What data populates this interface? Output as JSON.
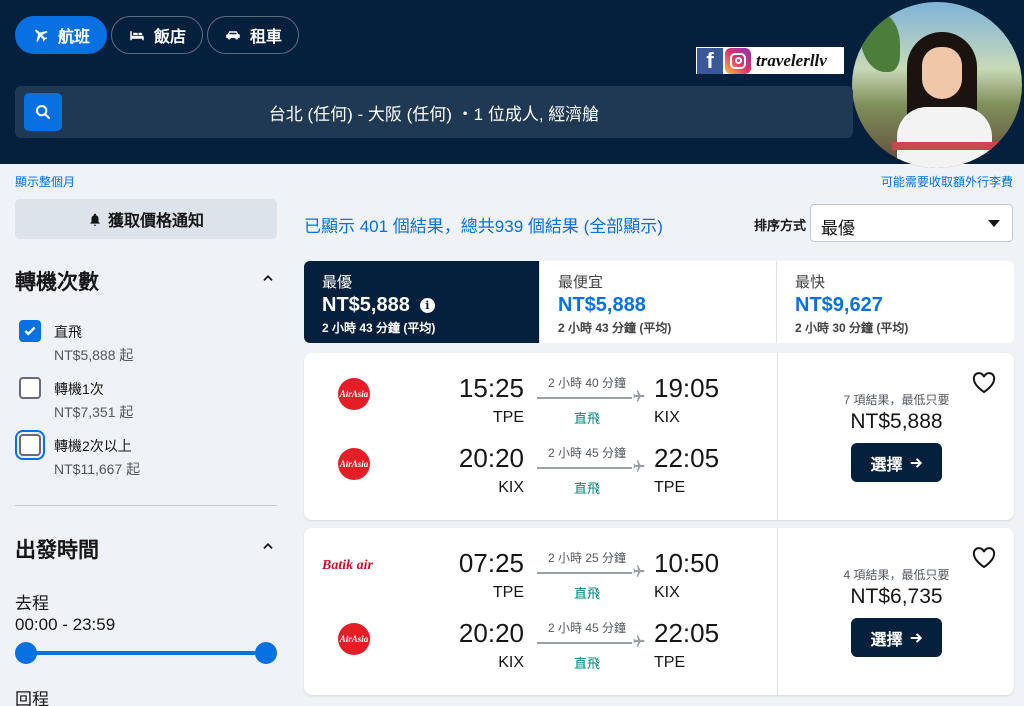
{
  "header": {
    "tabs": [
      {
        "label": "航班",
        "icon": "plane-icon",
        "active": true
      },
      {
        "label": "飯店",
        "icon": "bed-icon",
        "active": false
      },
      {
        "label": "租車",
        "icon": "car-icon",
        "active": false
      }
    ],
    "search_summary": "台北 (任何) - 大阪 (任何) ・1 位成人, 經濟艙",
    "watermark_handle": "travelerllv"
  },
  "left": {
    "show_month_link": "顯示整個月",
    "price_alert_label": "獲取價格通知",
    "stops_title": "轉機次數",
    "stops": [
      {
        "label": "直飛",
        "price": "NT$5,888 起",
        "checked": true
      },
      {
        "label": "轉機1次",
        "price": "NT$7,351 起",
        "checked": false
      },
      {
        "label": "轉機2次以上",
        "price": "NT$11,667 起",
        "checked": false
      }
    ],
    "departure_title": "出發時間",
    "outbound_label": "去程",
    "outbound_range": "00:00 - 23:59",
    "return_label": "回程"
  },
  "results": {
    "baggage_note": "可能需要收取額外行李費",
    "count_text": "已顯示 401 個結果，總共939 個結果 (全部顯示)",
    "sort_label": "排序方式",
    "sort_value": "最優",
    "sort_tabs": [
      {
        "name": "最優",
        "price": "NT$5,888",
        "duration": "2 小時 43 分鐘 (平均)",
        "active": true
      },
      {
        "name": "最便宜",
        "price": "NT$5,888",
        "duration": "2 小時 43 分鐘 (平均)",
        "active": false
      },
      {
        "name": "最快",
        "price": "NT$9,627",
        "duration": "2 小時 30 分鐘 (平均)",
        "active": false
      }
    ],
    "cards": [
      {
        "legs": [
          {
            "airline": "AirAsia",
            "dep_time": "15:25",
            "dep_code": "TPE",
            "duration": "2 小時 40 分鐘",
            "stops": "直飛",
            "arr_time": "19:05",
            "arr_code": "KIX"
          },
          {
            "airline": "AirAsia",
            "dep_time": "20:20",
            "dep_code": "KIX",
            "duration": "2 小時 45 分鐘",
            "stops": "直飛",
            "arr_time": "22:05",
            "arr_code": "TPE"
          }
        ],
        "count": "7 項結果，最低只要",
        "price": "NT$5,888",
        "button": "選擇"
      },
      {
        "legs": [
          {
            "airline": "Batik air",
            "dep_time": "07:25",
            "dep_code": "TPE",
            "duration": "2 小時 25 分鐘",
            "stops": "直飛",
            "arr_time": "10:50",
            "arr_code": "KIX"
          },
          {
            "airline": "AirAsia",
            "dep_time": "20:20",
            "dep_code": "KIX",
            "duration": "2 小時 45 分鐘",
            "stops": "直飛",
            "arr_time": "22:05",
            "arr_code": "TPE"
          }
        ],
        "count": "4 項結果，最低只要",
        "price": "NT$6,735",
        "button": "選擇"
      }
    ]
  },
  "colors": {
    "header_bg": "#05203c",
    "accent": "#0770e3",
    "direct_green": "#00857a",
    "airasia_red": "#e41e26"
  }
}
